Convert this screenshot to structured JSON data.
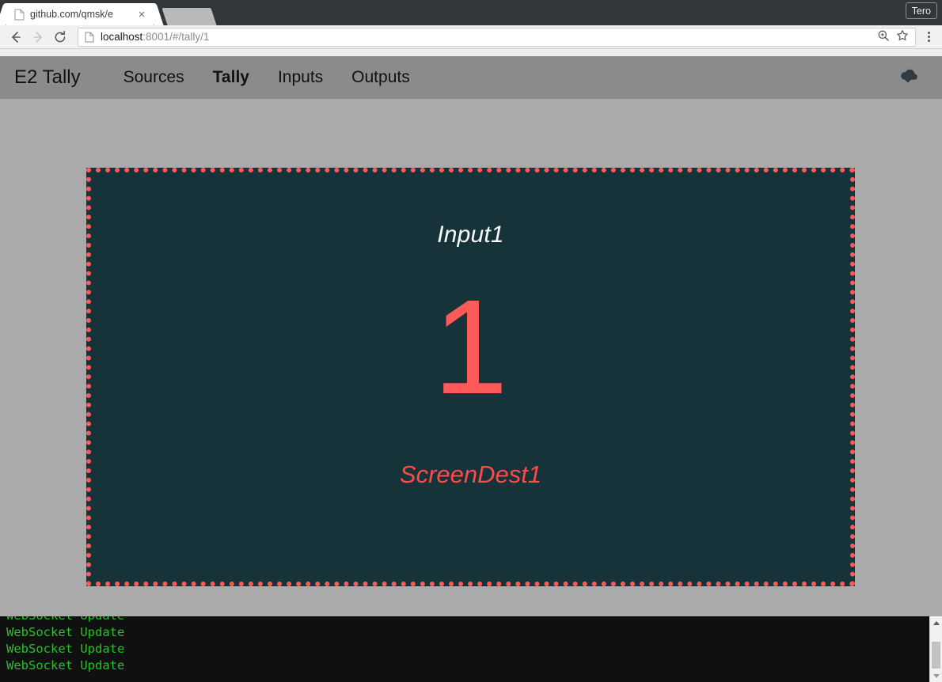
{
  "browser": {
    "tab": {
      "title": "github.com/qmsk/e",
      "favicon": "page-icon",
      "close": "×"
    },
    "profile": {
      "label": "Tero"
    },
    "toolbar": {
      "back": "back-arrow",
      "forward": "forward-arrow",
      "reload": "reload-icon",
      "page_icon": "page-icon",
      "url_host": "localhost",
      "url_rest": ":8001/#/tally/1",
      "url_full": "localhost:8001/#/tally/1",
      "zoom_icon": "zoom-search-icon",
      "bookmark_icon": "star-icon",
      "menu_icon": "three-dot-menu-icon"
    }
  },
  "navbar": {
    "brand": "E2 Tally",
    "links": [
      {
        "label": "Sources",
        "active": false
      },
      {
        "label": "Tally",
        "active": true
      },
      {
        "label": "Inputs",
        "active": false
      },
      {
        "label": "Outputs",
        "active": false
      }
    ],
    "status_icon": "cloud-download-icon",
    "background": "#8b8b8b"
  },
  "tally": {
    "source": "Input1",
    "id": "1",
    "destination": "ScreenDest1",
    "panel_background": "#153338",
    "border_color": "#ff5a5a",
    "id_color": "#ff5a5a",
    "source_color": "#fdfdfd",
    "destination_color": "#ff4a4a"
  },
  "console": {
    "lines": [
      "WebSocket Update",
      "WebSocket Update",
      "WebSocket Update",
      "WebSocket Update"
    ],
    "text_color": "#22c322",
    "background": "#101010",
    "scrollbar": {
      "up": "scroll-up-arrow",
      "down": "scroll-down-arrow"
    }
  }
}
